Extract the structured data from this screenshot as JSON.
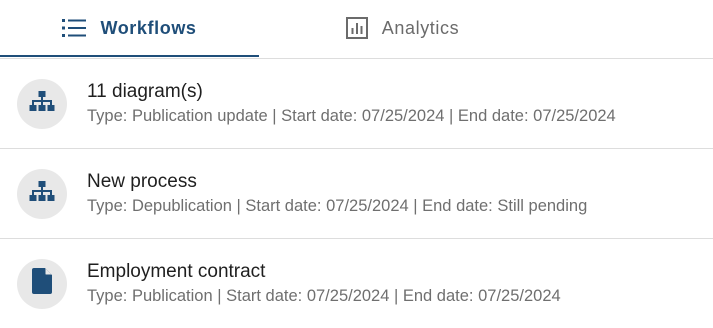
{
  "tabs": [
    {
      "label": "Workflows",
      "icon": "list-icon",
      "active": true
    },
    {
      "label": "Analytics",
      "icon": "bar-chart-icon",
      "active": false
    }
  ],
  "accent_color": "#1f4e79",
  "items": [
    {
      "title": "11 diagram(s)",
      "subtitle": "Type: Publication update | Start date: 07/25/2024 | End date: 07/25/2024",
      "icon": "sitemap-icon"
    },
    {
      "title": "New process",
      "subtitle": "Type: Depublication | Start date: 07/25/2024 | End date: Still pending",
      "icon": "sitemap-icon"
    },
    {
      "title": "Employment contract",
      "subtitle": "Type: Publication | Start date: 07/25/2024 | End date: 07/25/2024",
      "icon": "document-icon"
    }
  ]
}
